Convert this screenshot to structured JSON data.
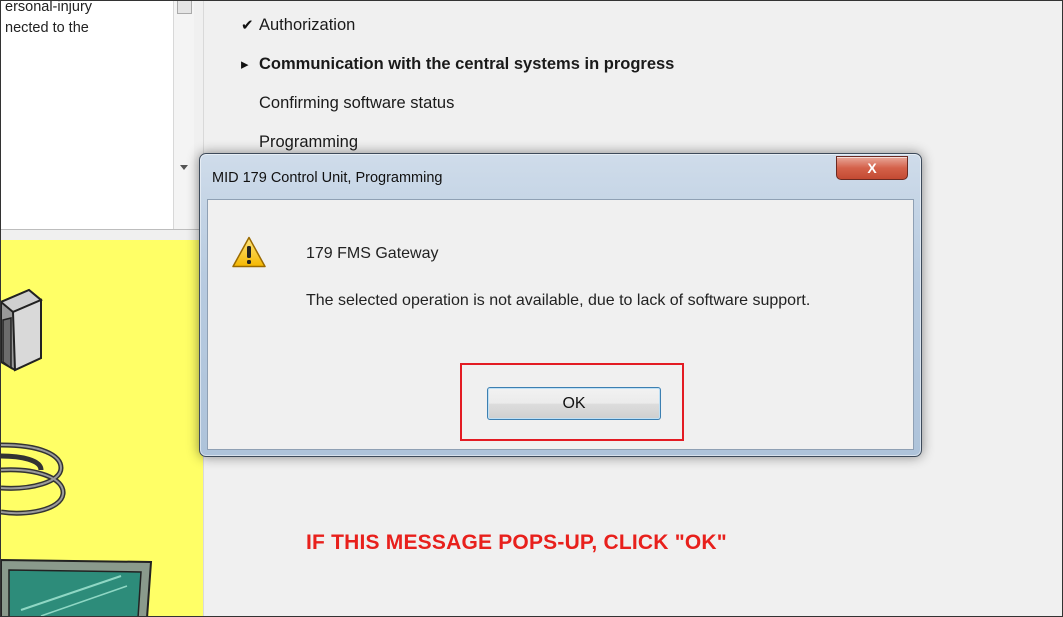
{
  "info_pane": {
    "lines": [
      "ersonal-injury",
      "nected to the"
    ]
  },
  "steps": [
    {
      "mark": "✔",
      "label": "Authorization",
      "state": "done"
    },
    {
      "mark": "▸",
      "label": "Communication with the central systems in progress",
      "state": "active"
    },
    {
      "mark": "",
      "label": "Confirming software status",
      "state": "pending"
    },
    {
      "mark": "",
      "label": "Programming",
      "state": "pending"
    }
  ],
  "dialog": {
    "title": "MID 179 Control Unit, Programming",
    "close_label": "X",
    "icon": "warning-icon",
    "heading": "179 FMS Gateway",
    "message": "The selected operation is not available, due to lack of software support.",
    "ok_label": "OK"
  },
  "instruction": "IF THIS MESSAGE POPS-UP, CLICK \"OK\"",
  "colors": {
    "illustration_bg": "#ffff66",
    "instruction": "#e8201c",
    "highlight_border": "#e31b23"
  }
}
